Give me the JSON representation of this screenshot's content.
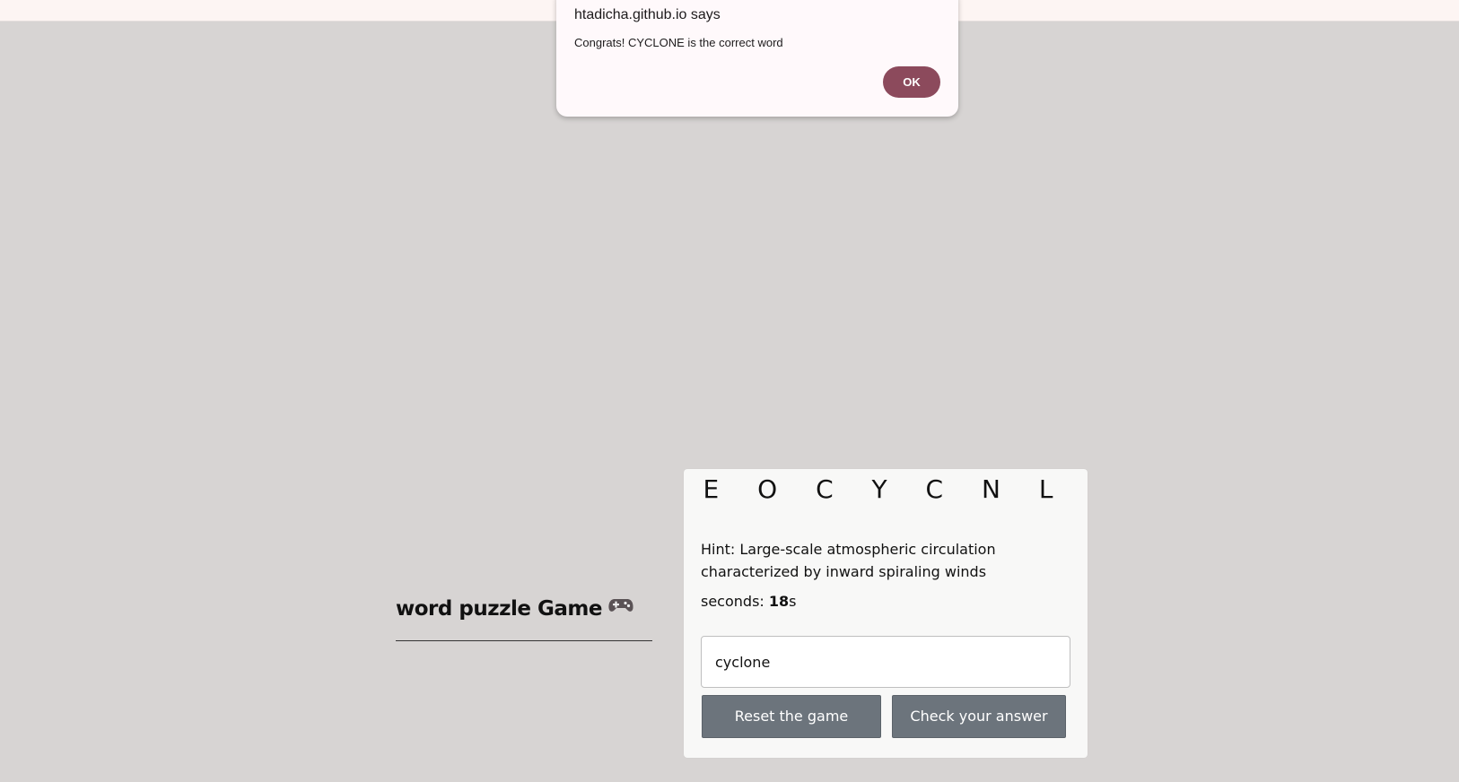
{
  "dialog": {
    "title": "htadicha.github.io says",
    "message": "Congrats! CYCLONE is the correct word",
    "ok_label": "OK",
    "ok_color": "#8c4a5c"
  },
  "game": {
    "title": "word puzzle Game",
    "title_icon": "gamepad-icon",
    "scrambled_word": "E O C Y C N L",
    "hint": "Hint: Large-scale atmospheric circulation characterized by inward spiraling winds",
    "timer_label": "seconds: ",
    "timer_value": "18",
    "timer_unit": "s",
    "answer_value": "cyclone",
    "reset_label": "Reset the game",
    "check_label": "Check your answer",
    "button_color": "#6c747c"
  }
}
